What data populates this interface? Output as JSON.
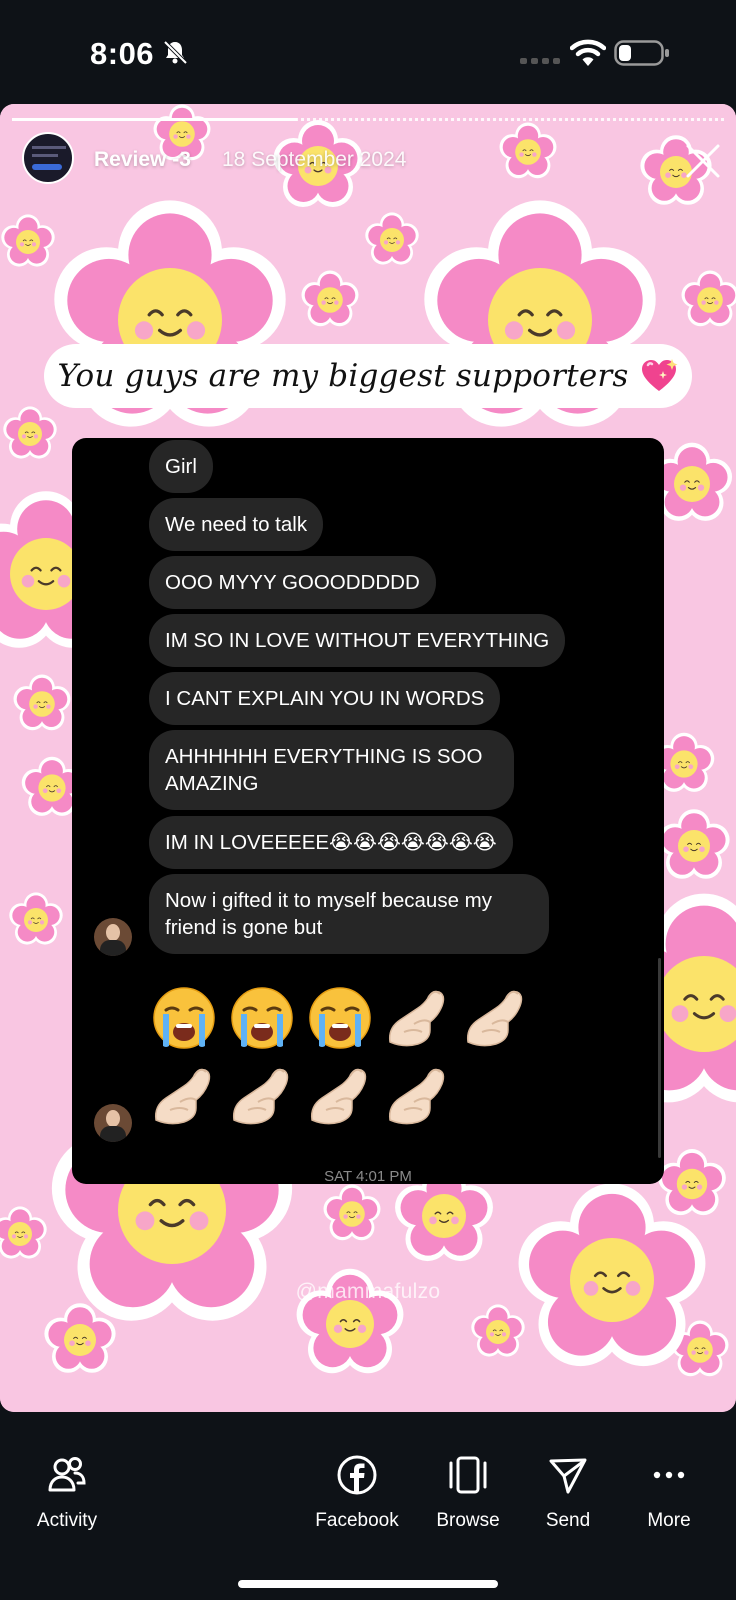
{
  "status_bar": {
    "time": "8:06"
  },
  "story": {
    "progress": 0.4,
    "user": "Review -3",
    "date": "18 September 2024",
    "caption": "You guys are my biggest supporters",
    "watermark": "@mammafulzo"
  },
  "chat": {
    "messages": [
      "Girl",
      "We need to talk",
      "OOO MYYY GOOODDDDD",
      "IM SO IN LOVE WITHOUT EVERYTHING",
      "I CANT EXPLAIN YOU IN WORDS",
      "AHHHHHH EVERYTHING IS SOO AMAZING",
      "IM IN LOVEEEEE😭😭😭😭😭😭😭",
      "Now i gifted it to myself because my friend is gone but"
    ],
    "emoji_row_1": [
      "crying-face",
      "crying-face",
      "crying-face",
      "pinched-fingers",
      "pinched-fingers"
    ],
    "emoji_row_2": [
      "pinched-fingers",
      "pinched-fingers",
      "pinched-fingers",
      "pinched-fingers"
    ],
    "timestamp": "SAT 4:01 PM"
  },
  "bottom_nav": {
    "activity": "Activity",
    "facebook": "Facebook",
    "browse": "Browse",
    "send": "Send",
    "more": "More"
  },
  "colors": {
    "story_bg": "#f9c6e2",
    "petal": "#f58ac6",
    "flower_center": "#fbe36a",
    "bubble": "#262626"
  }
}
